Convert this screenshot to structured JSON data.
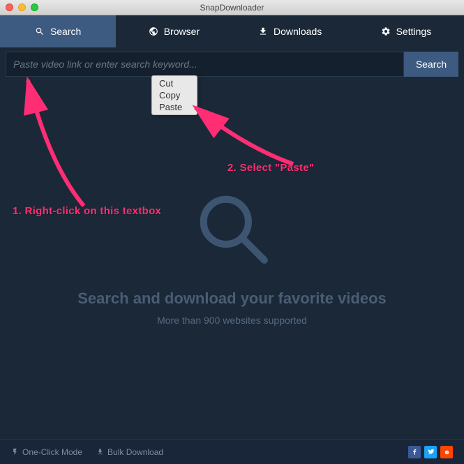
{
  "titlebar": {
    "title": "SnapDownloader"
  },
  "tabs": [
    {
      "label": "Search",
      "icon": "search-icon",
      "active": true
    },
    {
      "label": "Browser",
      "icon": "globe-icon",
      "active": false
    },
    {
      "label": "Downloads",
      "icon": "download-icon",
      "active": false
    },
    {
      "label": "Settings",
      "icon": "gear-icon",
      "active": false
    }
  ],
  "searchbar": {
    "placeholder": "Paste video link or enter search keyword...",
    "value": "",
    "button": "Search"
  },
  "context_menu": {
    "items": [
      "Cut",
      "Copy",
      "Paste"
    ]
  },
  "main": {
    "heading": "Search and download your favorite videos",
    "subheading": "More than 900 websites supported"
  },
  "footer": {
    "one_click": "One-Click Mode",
    "bulk": "Bulk Download"
  },
  "annotations": {
    "step1": "1. Right-click on this textbox",
    "step2": "2. Select \"Paste\""
  },
  "colors": {
    "bg": "#1b2838",
    "accent": "#3d5a80",
    "annotation": "#ff2e74"
  }
}
